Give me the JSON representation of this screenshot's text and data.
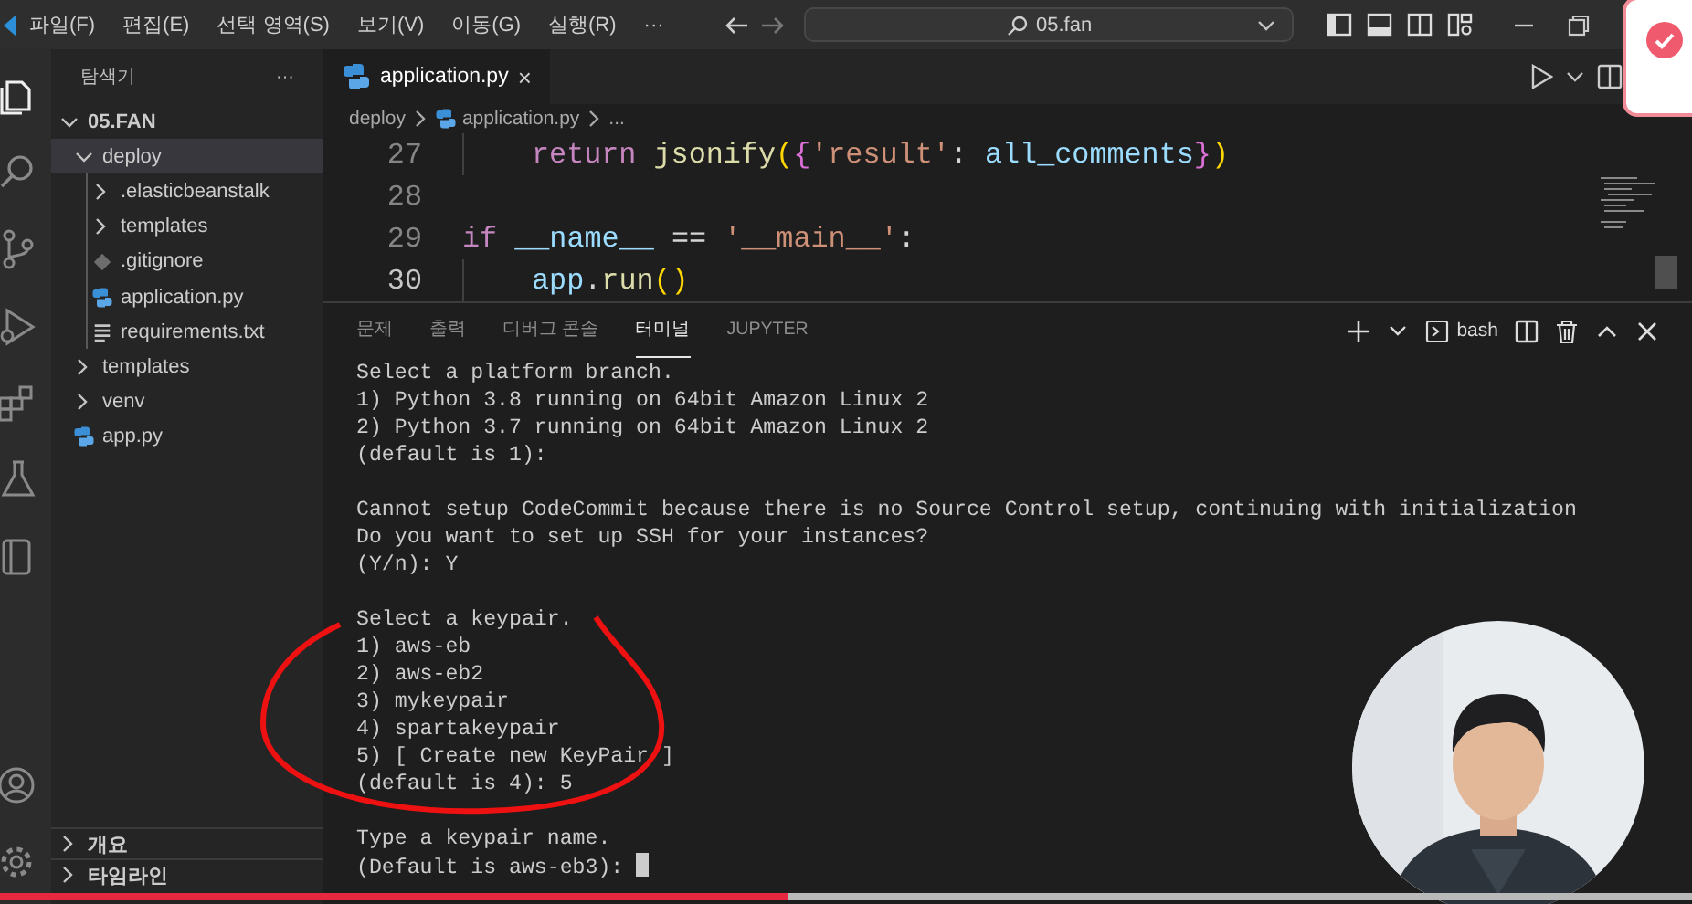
{
  "titlebar": {
    "menu": [
      "파일(F)",
      "편집(E)",
      "선택 영역(S)",
      "보기(V)",
      "이동(G)",
      "실행(R)"
    ],
    "more": "···",
    "search": "05.fan"
  },
  "activity_bar": {
    "top": [
      {
        "kind": "files",
        "selected": true
      },
      {
        "kind": "search",
        "selected": false
      },
      {
        "kind": "source-control",
        "selected": false
      },
      {
        "kind": "run",
        "selected": false
      },
      {
        "kind": "extensions",
        "selected": false
      },
      {
        "kind": "testing",
        "selected": false
      },
      {
        "kind": "book",
        "selected": false
      }
    ],
    "bottom": [
      {
        "kind": "account",
        "selected": false
      },
      {
        "kind": "settings",
        "selected": false
      }
    ]
  },
  "sidebar": {
    "title": "탐색기",
    "more": "···",
    "root": {
      "label": "05.FAN",
      "expanded": true
    },
    "tree": [
      {
        "label": "deploy",
        "kind": "folder",
        "expanded": true,
        "selected": true,
        "children": [
          {
            "label": ".elasticbeanstalk",
            "kind": "folder",
            "expanded": false,
            "selected": false
          },
          {
            "label": "templates",
            "kind": "folder",
            "expanded": false,
            "selected": false
          },
          {
            "label": ".gitignore",
            "kind": "git",
            "selected": false
          },
          {
            "label": "application.py",
            "kind": "python",
            "selected": false
          },
          {
            "label": "requirements.txt",
            "kind": "text",
            "selected": false
          }
        ]
      },
      {
        "label": "templates",
        "kind": "folder",
        "expanded": false,
        "selected": false
      },
      {
        "label": "venv",
        "kind": "folder",
        "expanded": false,
        "selected": false
      },
      {
        "label": "app.py",
        "kind": "python",
        "selected": false
      }
    ],
    "sections": [
      {
        "label": "개요",
        "expanded": false
      },
      {
        "label": "타임라인",
        "expanded": false
      }
    ]
  },
  "editor": {
    "tabs": [
      {
        "label": "application.py",
        "kind": "python",
        "selected": true,
        "close": "×"
      }
    ],
    "breadcrumb": [
      {
        "kind": "plain",
        "label": "deploy"
      },
      {
        "kind": "python",
        "label": "application.py"
      },
      {
        "kind": "plain",
        "label": "..."
      }
    ],
    "lines": [
      {
        "number": "27",
        "indented": true,
        "current": false,
        "tokens": [
          {
            "kind": "keyword",
            "text": "return"
          },
          {
            "kind": "function",
            "text": " jsonify"
          },
          {
            "kind": "bracket1",
            "text": "("
          },
          {
            "kind": "bracket2",
            "text": "{"
          },
          {
            "kind": "string",
            "text": "'result'"
          },
          {
            "kind": "plain",
            "text": ": "
          },
          {
            "kind": "variable",
            "text": "all_comments"
          },
          {
            "kind": "bracket2",
            "text": "}"
          },
          {
            "kind": "bracket1",
            "text": ")"
          }
        ]
      },
      {
        "number": "28",
        "current": false
      },
      {
        "number": "29",
        "indented": false,
        "current": false,
        "tokens": [
          {
            "kind": "keyword",
            "text": "if"
          },
          {
            "kind": "variable",
            "text": " __name__"
          },
          {
            "kind": "plain",
            "text": " == "
          },
          {
            "kind": "string",
            "text": "'__main__'"
          },
          {
            "kind": "plain",
            "text": ":"
          }
        ]
      },
      {
        "number": "30",
        "indented": true,
        "current": true,
        "tokens": [
          {
            "kind": "variable",
            "text": "app"
          },
          {
            "kind": "plain",
            "text": "."
          },
          {
            "kind": "function",
            "text": "run"
          },
          {
            "kind": "bracket1",
            "text": "()"
          }
        ]
      }
    ]
  },
  "panel": {
    "tabs": [
      {
        "label": "문제",
        "selected": false
      },
      {
        "label": "출력",
        "selected": false
      },
      {
        "label": "디버그 콘솔",
        "selected": false
      },
      {
        "label": "터미널",
        "selected": true
      },
      {
        "label": "JUPYTER",
        "selected": false
      }
    ],
    "shell": "bash",
    "terminal": {
      "cursor": true,
      "blocks": [
        [
          "Select a platform branch.",
          "1) Python 3.8 running on 64bit Amazon Linux 2",
          "2) Python 3.7 running on 64bit Amazon Linux 2",
          "(default is 1):"
        ],
        [
          "Cannot setup CodeCommit because there is no Source Control setup, continuing with initialization",
          "Do you want to set up SSH for your instances?",
          "(Y/n): Y"
        ],
        [
          "Select a keypair.",
          "1) aws-eb",
          "2) aws-eb2",
          "3) mykeypair",
          "4) spartakeypair",
          "5) [ Create new KeyPair ]",
          "(default is 4): 5"
        ],
        [
          "Type a keypair name.",
          "(Default is aws-eb3):"
        ]
      ]
    }
  },
  "overlay": {
    "annotation": true,
    "notification": {
      "kind": "success"
    },
    "video_progress": {
      "level": 0.465
    }
  }
}
